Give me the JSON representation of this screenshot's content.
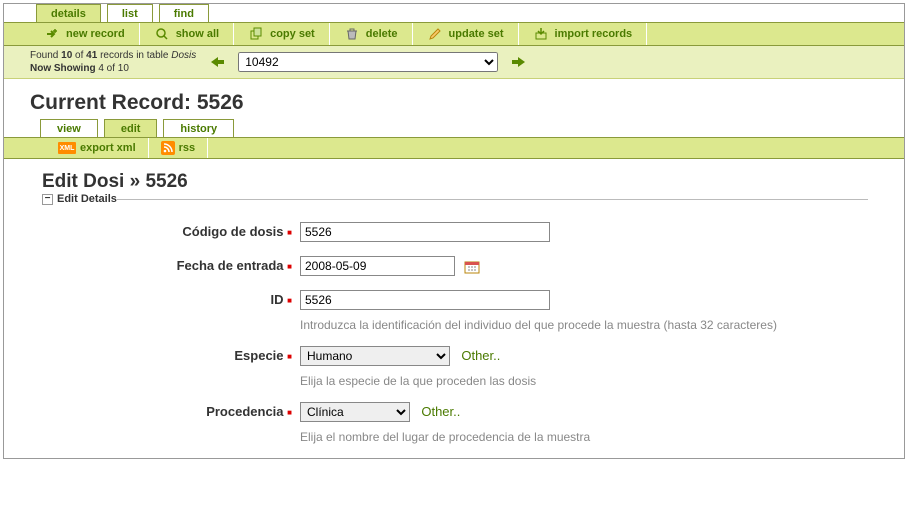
{
  "top_tabs": {
    "details": "details",
    "list": "list",
    "find": "find"
  },
  "actions": {
    "new_record": "new record",
    "show_all": "show all",
    "copy_set": "copy set",
    "delete": "delete",
    "update_set": "update set",
    "import_records": "import records"
  },
  "found": {
    "prefix": "Found ",
    "shown": "10",
    "of_word": " of ",
    "total": "41",
    "rest": " records in table ",
    "table": "Dosis",
    "now_prefix": "Now Showing ",
    "now_n": "4",
    "now_of": " of ",
    "now_total": "10",
    "select_value": "10492"
  },
  "heading": {
    "current_record_prefix": "Current Record: ",
    "current_record_id": "5526"
  },
  "sub_tabs": {
    "view": "view",
    "edit": "edit",
    "history": "history"
  },
  "sub_actions": {
    "export_xml": "export xml",
    "rss": "rss"
  },
  "edit_title": {
    "prefix": "Edit Dosi » ",
    "id": "5526"
  },
  "section_label": "Edit Details",
  "fields": {
    "codigo": {
      "label": "Código de dosis",
      "value": "5526"
    },
    "fecha": {
      "label": "Fecha de entrada",
      "value": "2008-05-09"
    },
    "id": {
      "label": "ID",
      "value": "5526",
      "hint": "Introduzca la identificación del individuo del que procede la muestra (hasta 32 caracteres)"
    },
    "especie": {
      "label": "Especie",
      "value": "Humano",
      "other": "Other..",
      "hint": "Elija la especie de la que proceden las dosis"
    },
    "procedencia": {
      "label": "Procedencia",
      "value": "Clínica",
      "other": "Other..",
      "hint": "Elija el nombre del lugar de procedencia de la muestra"
    }
  }
}
